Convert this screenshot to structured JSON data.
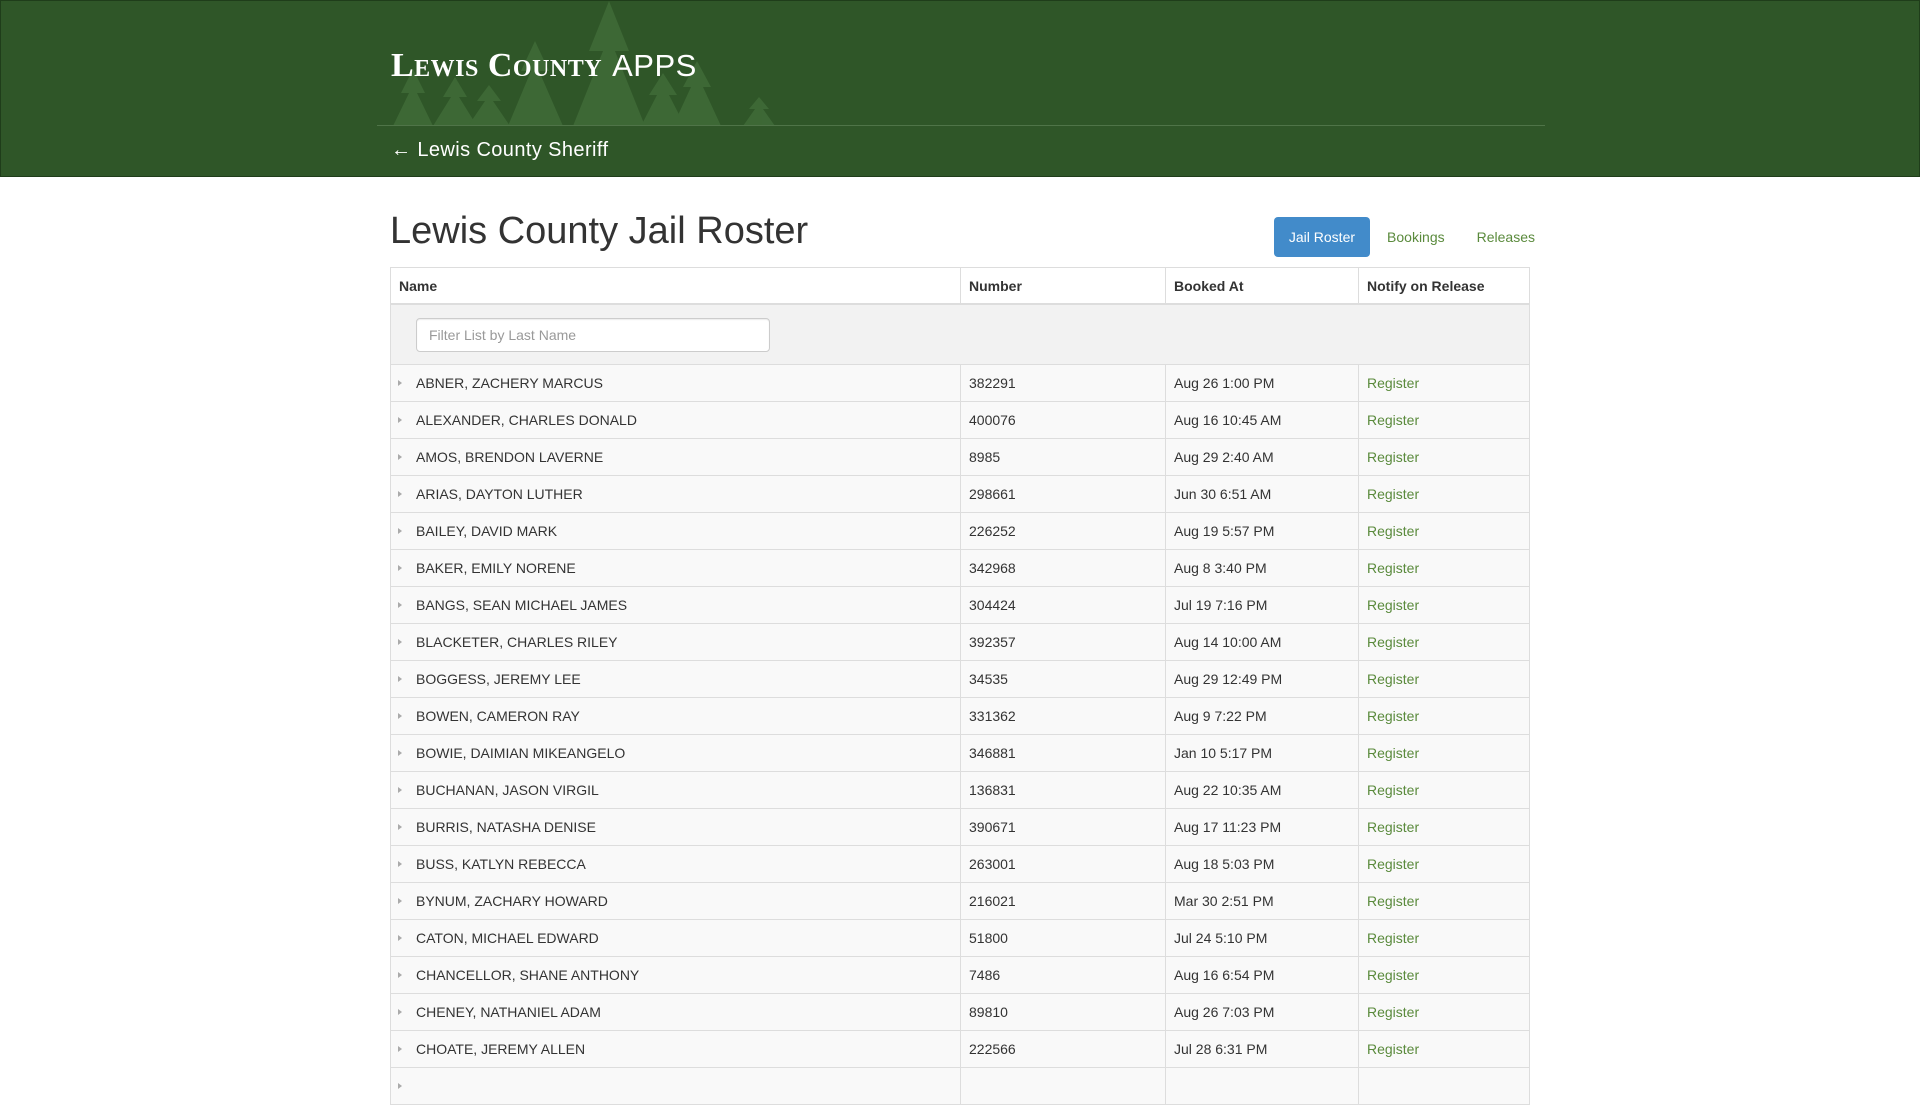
{
  "header": {
    "brand_main": "Lewis County",
    "brand_sub": "APPS",
    "back_link": "← Lewis County Sheriff",
    "background_color": "#2f5628"
  },
  "page": {
    "title": "Lewis County Jail Roster"
  },
  "tabs": [
    {
      "label": "Jail Roster",
      "active": true
    },
    {
      "label": "Bookings",
      "active": false
    },
    {
      "label": "Releases",
      "active": false
    }
  ],
  "table": {
    "columns": [
      "Name",
      "Number",
      "Booked At",
      "Notify on Release"
    ],
    "filter_placeholder": "Filter List by Last Name",
    "rows": [
      {
        "name": "ABNER, ZACHERY MARCUS",
        "number": "382291",
        "booked": "Aug 26 1:00 PM",
        "notify": "Register"
      },
      {
        "name": "ALEXANDER, CHARLES DONALD",
        "number": "400076",
        "booked": "Aug 16 10:45 AM",
        "notify": "Register"
      },
      {
        "name": "AMOS, BRENDON LAVERNE",
        "number": "8985",
        "booked": "Aug 29 2:40 AM",
        "notify": "Register"
      },
      {
        "name": "ARIAS, DAYTON LUTHER",
        "number": "298661",
        "booked": "Jun 30 6:51 AM",
        "notify": "Register"
      },
      {
        "name": "BAILEY, DAVID MARK",
        "number": "226252",
        "booked": "Aug 19 5:57 PM",
        "notify": "Register"
      },
      {
        "name": "BAKER, EMILY NORENE",
        "number": "342968",
        "booked": "Aug 8 3:40 PM",
        "notify": "Register"
      },
      {
        "name": "BANGS, SEAN MICHAEL JAMES",
        "number": "304424",
        "booked": "Jul 19 7:16 PM",
        "notify": "Register"
      },
      {
        "name": "BLACKETER, CHARLES RILEY",
        "number": "392357",
        "booked": "Aug 14 10:00 AM",
        "notify": "Register"
      },
      {
        "name": "BOGGESS, JEREMY LEE",
        "number": "34535",
        "booked": "Aug 29 12:49 PM",
        "notify": "Register"
      },
      {
        "name": "BOWEN, CAMERON RAY",
        "number": "331362",
        "booked": "Aug 9 7:22 PM",
        "notify": "Register"
      },
      {
        "name": "BOWIE, DAIMIAN MIKEANGELO",
        "number": "346881",
        "booked": "Jan 10 5:17 PM",
        "notify": "Register"
      },
      {
        "name": "BUCHANAN, JASON VIRGIL",
        "number": "136831",
        "booked": "Aug 22 10:35 AM",
        "notify": "Register"
      },
      {
        "name": "BURRIS, NATASHA DENISE",
        "number": "390671",
        "booked": "Aug 17 11:23 PM",
        "notify": "Register"
      },
      {
        "name": "BUSS, KATLYN REBECCA",
        "number": "263001",
        "booked": "Aug 18 5:03 PM",
        "notify": "Register"
      },
      {
        "name": "BYNUM, ZACHARY HOWARD",
        "number": "216021",
        "booked": "Mar 30 2:51 PM",
        "notify": "Register"
      },
      {
        "name": "CATON, MICHAEL EDWARD",
        "number": "51800",
        "booked": "Jul 24 5:10 PM",
        "notify": "Register"
      },
      {
        "name": "CHANCELLOR, SHANE ANTHONY",
        "number": "7486",
        "booked": "Aug 16 6:54 PM",
        "notify": "Register"
      },
      {
        "name": "CHENEY, NATHANIEL ADAM",
        "number": "89810",
        "booked": "Aug 26 7:03 PM",
        "notify": "Register"
      },
      {
        "name": "CHOATE, JEREMY ALLEN",
        "number": "222566",
        "booked": "Jul 28 6:31 PM",
        "notify": "Register"
      },
      {
        "name": "",
        "number": "",
        "booked": "",
        "notify": ""
      }
    ]
  }
}
